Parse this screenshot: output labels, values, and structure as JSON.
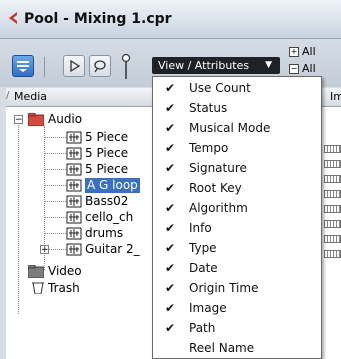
{
  "window": {
    "title": "Pool - Mixing 1.cpr"
  },
  "toolbar": {
    "view_attributes_label": "View / Attributes",
    "all_label_1": "All",
    "all_label_2": "All"
  },
  "columns": {
    "media": "Media",
    "im": "Im"
  },
  "tree": {
    "audio": "Audio",
    "items": [
      {
        "label": "5 Piece"
      },
      {
        "label": "5 Piece"
      },
      {
        "label": "5 Piece"
      },
      {
        "label": "A G loop"
      },
      {
        "label": "Bass02"
      },
      {
        "label": "cello_ch"
      },
      {
        "label": "drums"
      },
      {
        "label": "Guitar 2_"
      }
    ],
    "video": "Video",
    "trash": "Trash"
  },
  "menu": {
    "items": [
      {
        "label": "Use Count",
        "checked": true
      },
      {
        "label": "Status",
        "checked": true
      },
      {
        "label": "Musical Mode",
        "checked": true
      },
      {
        "label": "Tempo",
        "checked": true
      },
      {
        "label": "Signature",
        "checked": true
      },
      {
        "label": "Root Key",
        "checked": true
      },
      {
        "label": "Algorithm",
        "checked": true
      },
      {
        "label": "Info",
        "checked": true
      },
      {
        "label": "Type",
        "checked": true
      },
      {
        "label": "Date",
        "checked": true
      },
      {
        "label": "Origin Time",
        "checked": true
      },
      {
        "label": "Image",
        "checked": true
      },
      {
        "label": "Path",
        "checked": true
      },
      {
        "label": "Reel Name",
        "checked": false
      }
    ],
    "check_glyph": "✔"
  },
  "colors": {
    "selection": "#3b6fc2",
    "accent": "#2f6fc4",
    "title_icon": "#c0392b"
  }
}
